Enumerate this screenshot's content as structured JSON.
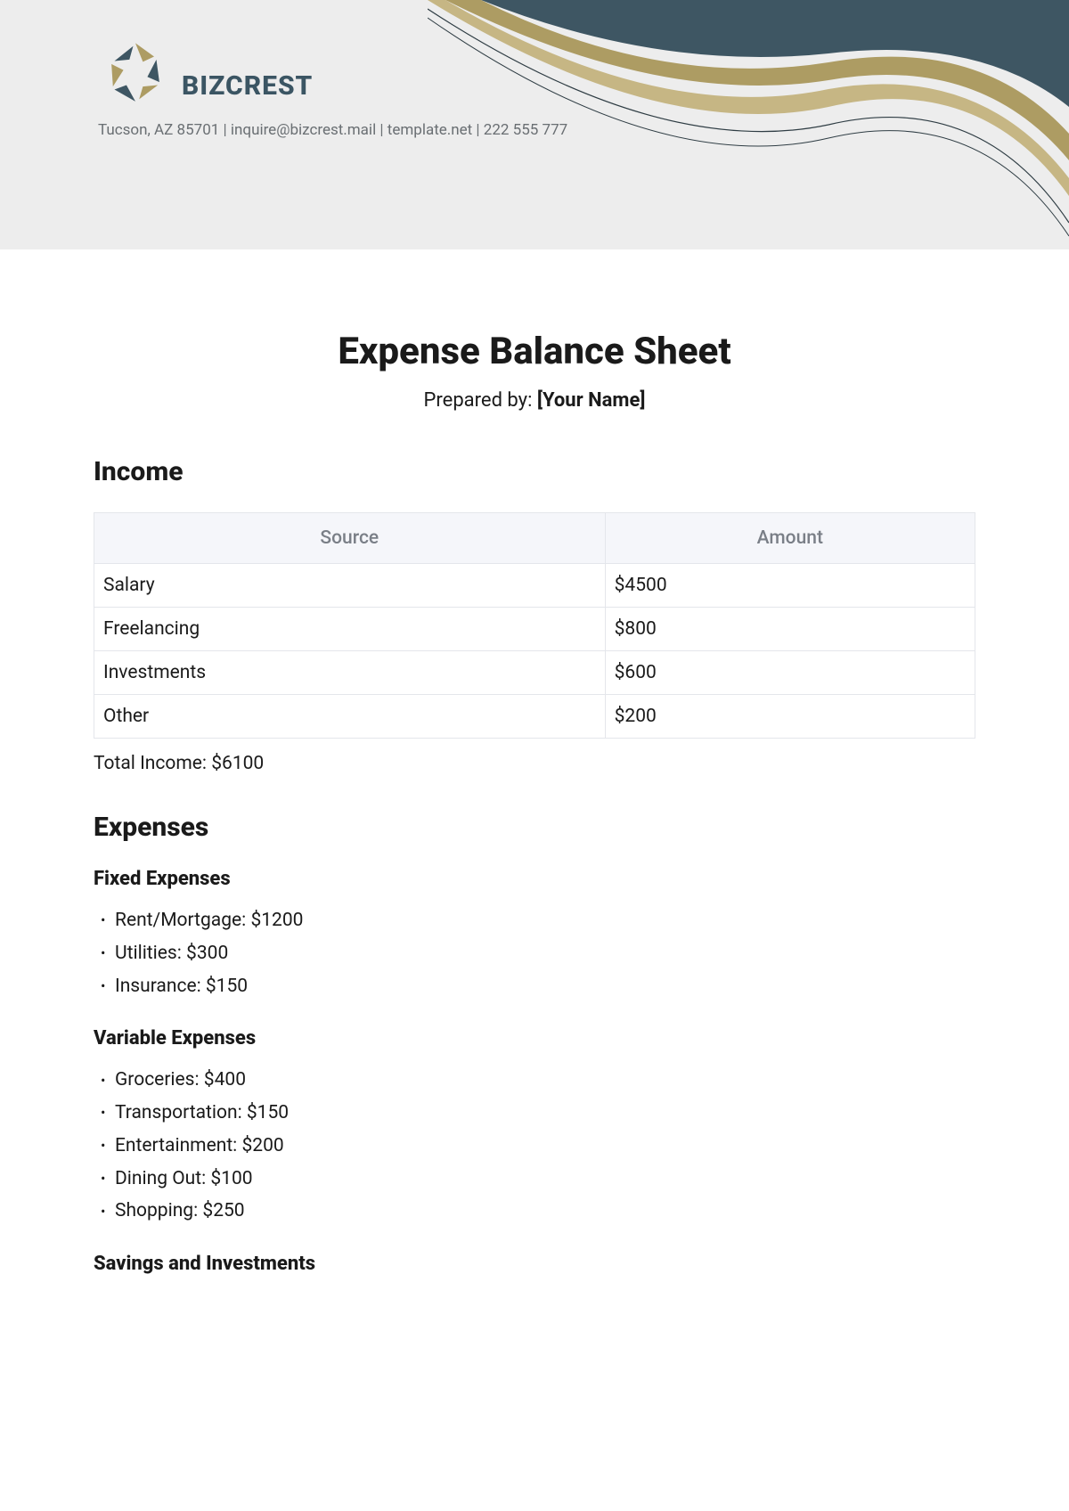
{
  "brand": "BIZCREST",
  "contact": "Tucson, AZ 85701 | inquire@bizcrest.mail | template.net | 222 555 777",
  "title": "Expense Balance Sheet",
  "prepared_label": "Prepared by: ",
  "prepared_value": "[Your Name]",
  "income": {
    "heading": "Income",
    "columns": [
      "Source",
      "Amount"
    ],
    "rows": [
      {
        "source": "Salary",
        "amount": "$4500"
      },
      {
        "source": "Freelancing",
        "amount": "$800"
      },
      {
        "source": "Investments",
        "amount": "$600"
      },
      {
        "source": "Other",
        "amount": "$200"
      }
    ],
    "total": "Total Income: $6100"
  },
  "expenses": {
    "heading": "Expenses",
    "fixed": {
      "heading": "Fixed Expenses",
      "items": [
        "Rent/Mortgage: $1200",
        "Utilities: $300",
        "Insurance: $150"
      ]
    },
    "variable": {
      "heading": "Variable Expenses",
      "items": [
        "Groceries: $400",
        "Transportation: $150",
        "Entertainment: $200",
        "Dining Out: $100",
        "Shopping: $250"
      ]
    },
    "savings": {
      "heading": "Savings and Investments"
    }
  }
}
